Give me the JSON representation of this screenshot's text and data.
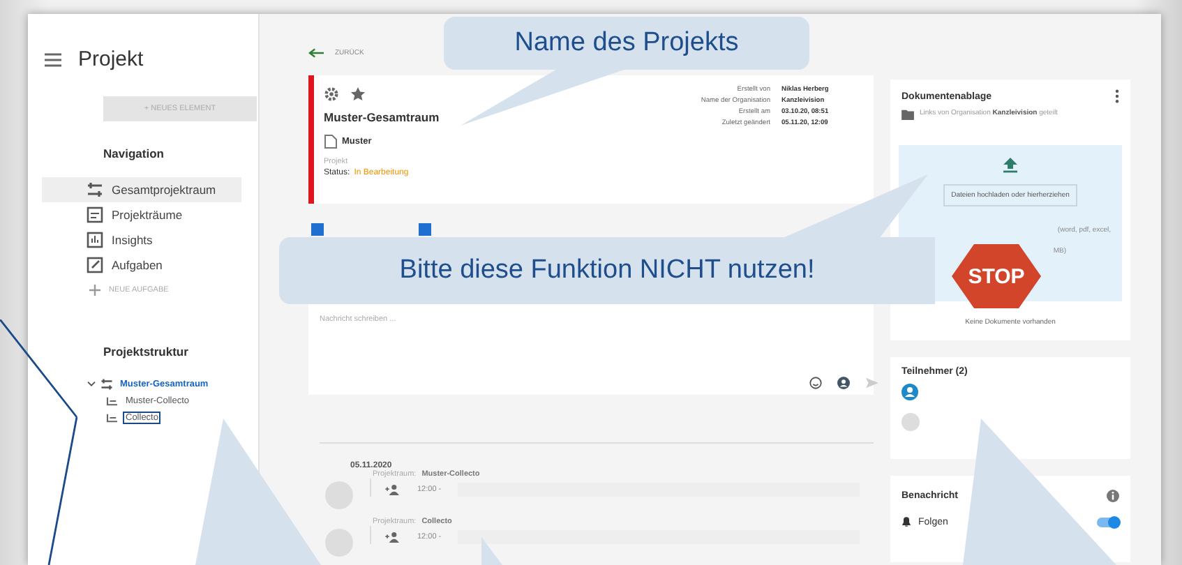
{
  "sidebar": {
    "title": "Projekt",
    "new_button": "+ NEUES ELEMENT",
    "navigation_heading": "Navigation",
    "nav_items": [
      {
        "label": "Gesamtprojektraum",
        "selected": true,
        "kind": "rooms"
      },
      {
        "label": "Projekträume",
        "selected": false,
        "kind": "room"
      },
      {
        "label": "Insights",
        "selected": false,
        "kind": "chart"
      },
      {
        "label": "Aufgaben",
        "selected": false,
        "kind": "task"
      }
    ],
    "new_task": "NEUE AUFGABE",
    "structure_heading": "Projektstruktur",
    "tree": [
      {
        "label": "Muster-Gesamtraum",
        "expanded": true,
        "marked": false,
        "children": [
          {
            "label": "Muster-Collecto",
            "marked": false
          },
          {
            "label": "Collecto",
            "marked": true
          }
        ]
      }
    ]
  },
  "main": {
    "back": "ZURÜCK",
    "project": {
      "name": "Muster-Gesamtraum",
      "template": "Muster",
      "type": "Projekt",
      "status_label": "Status:",
      "status": "In Bearbeitung",
      "meta": [
        {
          "label": "Erstellt von",
          "value": "Niklas Herberg"
        },
        {
          "label": "Name der Organisation",
          "value": "Kanzleivision"
        },
        {
          "label": "Erstellt am",
          "value": "03.10.20, 08:51"
        },
        {
          "label": "Zuletzt geändert",
          "value": "05.11.20, 12:09"
        }
      ]
    },
    "filters": [
      {
        "checked": true
      },
      {
        "checked": true
      }
    ],
    "composer": {
      "placeholder": "Nachricht schreiben ..."
    },
    "date": "05.11.2020",
    "feed": [
      {
        "room_label": "Projektraum:",
        "room": "Muster-Collecto",
        "time": "12:00 -"
      },
      {
        "room_label": "Projektraum:",
        "room": "Collecto",
        "time": "12:00 -"
      }
    ]
  },
  "documents": {
    "title": "Dokumentenablage",
    "info": "Links von Organisation **Kanzleivision** geteilt",
    "upload": "Dateien hochladen oder hierherziehen",
    "hint_1": "(word, pdf, excel,",
    "hint_2": "MB)",
    "empty": "Keine Dokumente vorhanden"
  },
  "participants": {
    "title": "Teilnehmer (2)",
    "members": [
      {
        "kind": "icon"
      },
      {
        "kind": "photo"
      }
    ]
  },
  "notifications": {
    "title": "Benachricht",
    "follow": "Folgen",
    "on": true
  },
  "annotations": [
    {
      "kind": "callout",
      "text": "Name des Projekts"
    },
    {
      "kind": "warning",
      "text": "Bitte diese Funktion NICHT nutzen!",
      "badge": "STOP"
    }
  ]
}
